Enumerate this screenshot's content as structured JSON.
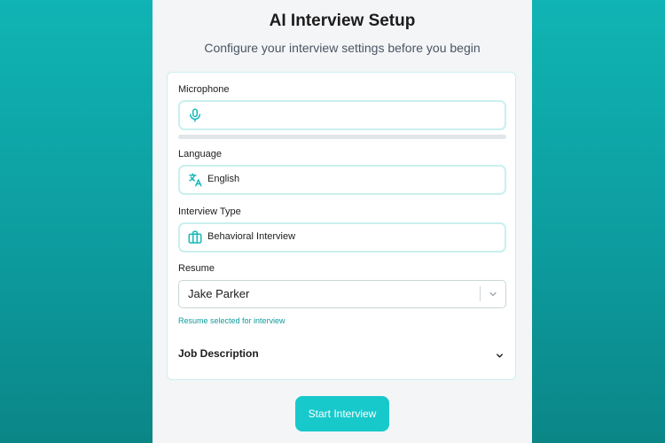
{
  "page": {
    "title": "AI Interview Setup",
    "subtitle": "Configure your interview settings before you begin"
  },
  "microphone": {
    "label": "Microphone",
    "value": "",
    "icon": "microphone-icon",
    "level": 0
  },
  "language": {
    "label": "Language",
    "value": "English",
    "icon": "translate-icon"
  },
  "interview_type": {
    "label": "Interview Type",
    "value": "Behavioral Interview",
    "icon": "briefcase-icon"
  },
  "resume": {
    "label": "Resume",
    "selected": "Jake Parker",
    "help_text": "Resume selected for interview",
    "icon": "chevron-down-icon"
  },
  "job_description": {
    "label": "Job Description",
    "icon": "chevron-down-icon"
  },
  "actions": {
    "start_label": "Start Interview"
  },
  "colors": {
    "accent": "#18c9cb",
    "background_top": "#10b4b4",
    "background_bottom": "#0b8687",
    "field_border": "#c9f0ee",
    "help_text": "#0e9c9c"
  }
}
